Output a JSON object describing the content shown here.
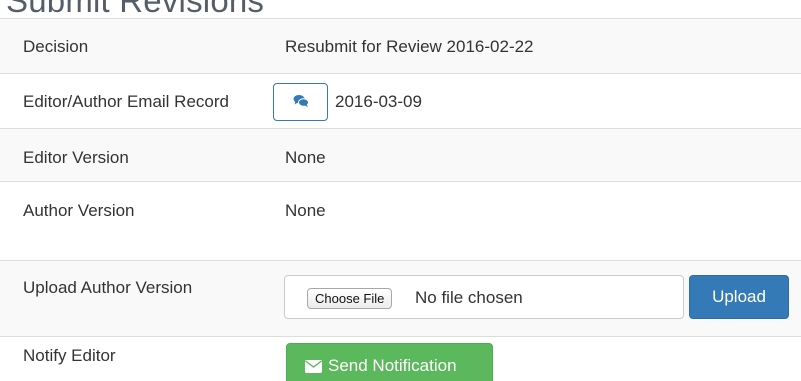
{
  "page": {
    "title": "Submit Revisions"
  },
  "rows": {
    "decision": {
      "label": "Decision",
      "value": "Resubmit for Review 2016-02-22"
    },
    "email_record": {
      "label": "Editor/Author Email Record",
      "icon": "comments-icon",
      "date": "2016-03-09"
    },
    "editor_version": {
      "label": "Editor Version",
      "value": "None"
    },
    "author_version": {
      "label": "Author Version",
      "value": "None"
    },
    "upload": {
      "label": "Upload Author Version",
      "choose_file_label": "Choose File",
      "file_status": "No file chosen",
      "upload_button_label": "Upload"
    },
    "notify": {
      "label": "Notify Editor",
      "icon": "envelope-icon",
      "button_label": "Send Notification"
    }
  },
  "colors": {
    "primary": "#337ab7",
    "success": "#5cb85c",
    "stripe": "#f9f9f9",
    "heading": "#555d66"
  }
}
